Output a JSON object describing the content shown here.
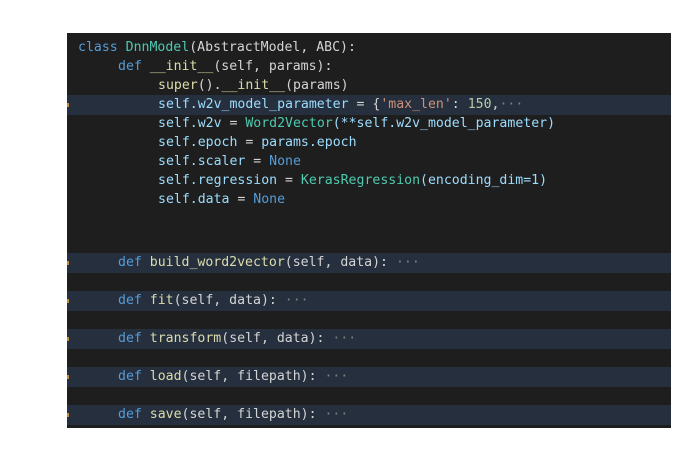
{
  "editor": {
    "lines": [
      {
        "kw": "class",
        "name": "DnnModel",
        "rest": "(AbstractModel, ABC):"
      },
      {
        "kw": "def",
        "name": "__init__",
        "rest": "(self, params):"
      },
      {
        "super": "super",
        "mid": "().",
        "name": "__init__",
        "rest": "(params)"
      },
      {
        "self": "self.w2v_model_parameter",
        "eq": " = {",
        "str": "'max_len'",
        "colon": ": ",
        "num": "150",
        "comma": ",",
        "ell": "···"
      },
      {
        "self": "self.w2v",
        "eq": " = ",
        "cls": "Word2Vector",
        "rest": "(**self.w2v_model_parameter)"
      },
      {
        "self": "self.epoch",
        "eq": " = ",
        "rest": "params.epoch"
      },
      {
        "self": "self.scaler",
        "eq": " = ",
        "kw": "None"
      },
      {
        "self": "self.regression",
        "eq": " = ",
        "cls": "KerasRegression",
        "rest": "(encoding_dim=1)"
      },
      {
        "self": "self.data",
        "eq": " = ",
        "kw": "None"
      },
      {
        "kw": "def",
        "name": "build_word2vector",
        "rest": "(self, data):",
        "ell": "···"
      },
      {
        "kw": "def",
        "name": "fit",
        "rest": "(self, data):",
        "ell": "···"
      },
      {
        "kw": "def",
        "name": "transform",
        "rest": "(self, data):",
        "ell": "···"
      },
      {
        "kw": "def",
        "name": "load",
        "rest": "(self, filepath):",
        "ell": "···"
      },
      {
        "kw": "def",
        "name": "save",
        "rest": "(self, filepath):",
        "ell": "···"
      }
    ]
  },
  "colors": {
    "background": "#1e1e1e",
    "keyword": "#569cd6",
    "function": "#dcdcaa",
    "class": "#4ec9b0",
    "variable": "#9cdcfe",
    "string": "#ce9178",
    "number": "#b5cea8",
    "highlight": "#262f3d"
  }
}
